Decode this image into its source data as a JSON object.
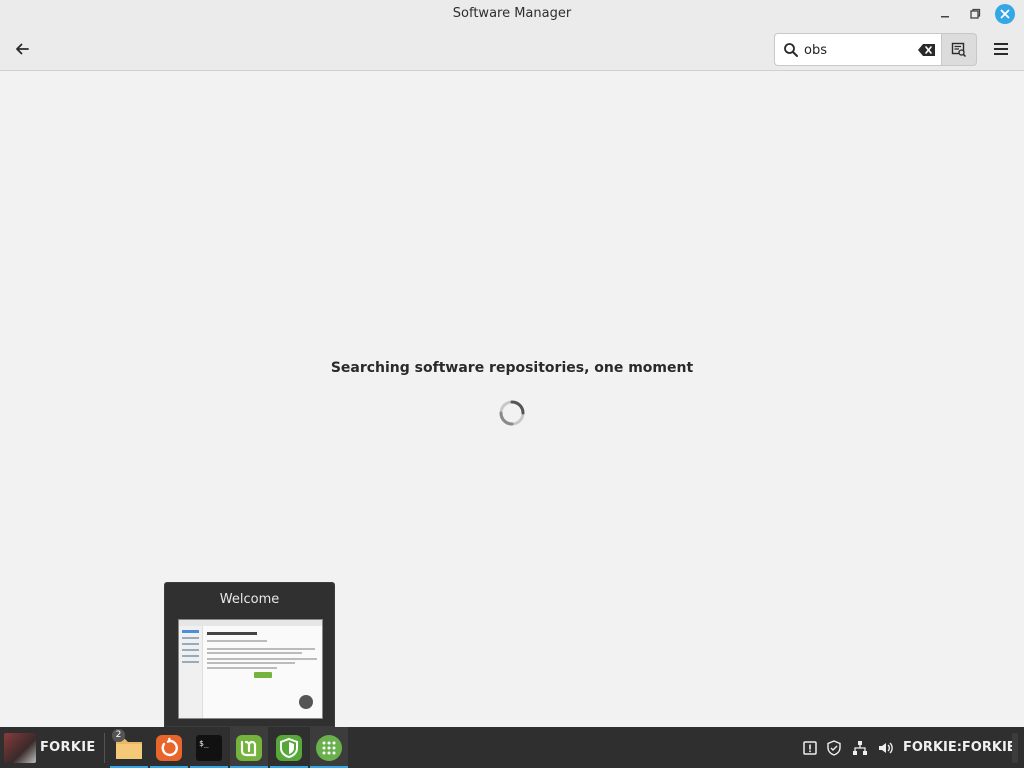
{
  "window": {
    "title": "Software Manager"
  },
  "search": {
    "value": "obs",
    "placeholder": ""
  },
  "content": {
    "status_message": "Searching software repositories, one moment"
  },
  "preview": {
    "title": "Welcome"
  },
  "taskbar": {
    "menu_label": "FORKIE",
    "file_manager_badge": "2",
    "user_label": "FORKIE:FORKIE",
    "launchers": [
      {
        "name": "file-manager",
        "icon": "folder-icon"
      },
      {
        "name": "update-manager",
        "icon": "update-manager-icon"
      },
      {
        "name": "terminal",
        "icon": "terminal-icon"
      },
      {
        "name": "mintinstall",
        "icon": "mint-logo-icon"
      },
      {
        "name": "shield",
        "icon": "shield-icon"
      },
      {
        "name": "welcome",
        "icon": "welcome-icon"
      }
    ]
  },
  "colors": {
    "accent": "#35a6e6",
    "mint_green": "#74b33c",
    "taskbar_bg": "#2f2f2f",
    "window_bg": "#f2f2f2"
  }
}
